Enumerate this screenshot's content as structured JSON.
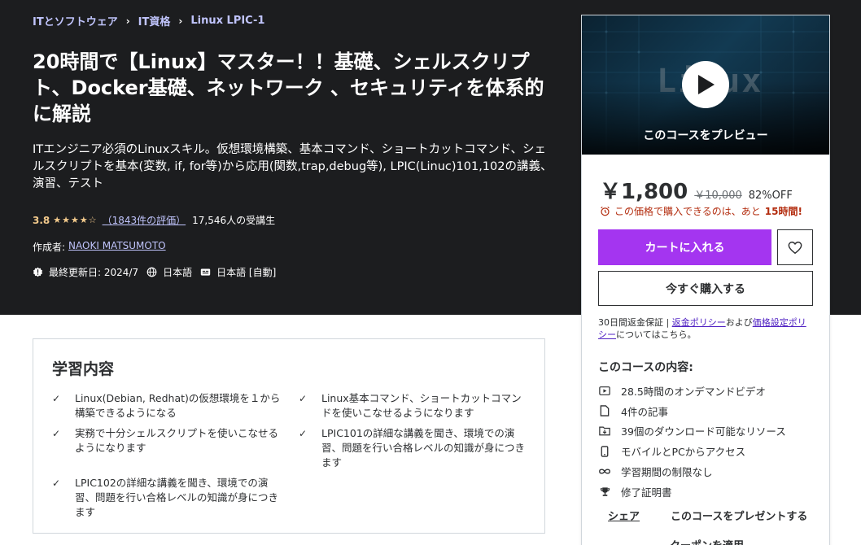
{
  "breadcrumb": {
    "items": [
      "ITとソフトウェア",
      "IT資格",
      "Linux LPIC-1"
    ],
    "separator": "›"
  },
  "course": {
    "title": "20時間で【Linux】マスター！！基礎、シェルスクリプト、Docker基礎、ネットワーク 、セキュリティを体系的に解説",
    "headline": "ITエンジニア必須のLinuxスキル。仮想環境構築、基本コマンド、ショートカットコマンド、シェルスクリプトを基本(変数, if, for等)から応用(関数,trap,debug等), LPIC(Linuc)101,102の講義、演習、テスト",
    "rating": "3.8",
    "rating_value": 3.8,
    "stars_glyph": "★★★★☆",
    "rating_count": "（1843件の評価）",
    "students": "17,546人の受講生",
    "author_label": "作成者:",
    "author": "NAOKI MATSUMOTO",
    "last_updated": "最終更新日: 2024/7",
    "language": "日本語",
    "captions": "日本語 [自動]"
  },
  "learn": {
    "title": "学習内容",
    "items": [
      "Linux(Debian, Redhat)の仮想環境を１から構築できるようになる",
      "Linux基本コマンド、ショートカットコマンドを使いこなせるようになります",
      "実務で十分シェルスクリプトを使いこなせるようになります",
      "LPIC101の詳細な講義を聞き、環境での演習、問題を行い合格レベルの知識が身につきます",
      "LPIC102の詳細な講義を聞き、環境での演習、問題を行い合格レベルの知識が身につきます"
    ]
  },
  "sidebar": {
    "preview_label": "このコースをプレビュー",
    "preview_bg_text": "Linux",
    "price": "￥1,800",
    "original_price": "￥10,000",
    "discount": "82%OFF",
    "urgency_prefix": "この価格で購入できるのは、あと",
    "urgency_time": "15時間!",
    "cart_button": "カートに入れる",
    "buy_button": "今すぐ購入する",
    "guarantee_text": "30日間返金保証",
    "guarantee_sep": " | ",
    "refund_link": "返金ポリシー",
    "and_text": "および",
    "pricing_link": "価格設定ポリシー",
    "guarantee_suffix": "についてはこちら。",
    "includes_title": "このコースの内容:",
    "includes": [
      {
        "icon": "video-icon",
        "label": "28.5時間のオンデマンドビデオ"
      },
      {
        "icon": "article-icon",
        "label": "4件の記事"
      },
      {
        "icon": "download-icon",
        "label": "39個のダウンロード可能なリソース"
      },
      {
        "icon": "mobile-icon",
        "label": "モバイルとPCからアクセス"
      },
      {
        "icon": "infinity-icon",
        "label": "学習期間の制限なし"
      },
      {
        "icon": "trophy-icon",
        "label": "修了証明書"
      }
    ],
    "share": "シェア",
    "gift": "このコースをプレゼントする",
    "coupon": "クーポンを適用"
  },
  "colors": {
    "hero_bg": "#1c1d1f",
    "accent_purple": "#a435f0",
    "link_light": "#c0c4fc",
    "star": "#f3ca8c",
    "urgency": "#b32d0f"
  }
}
